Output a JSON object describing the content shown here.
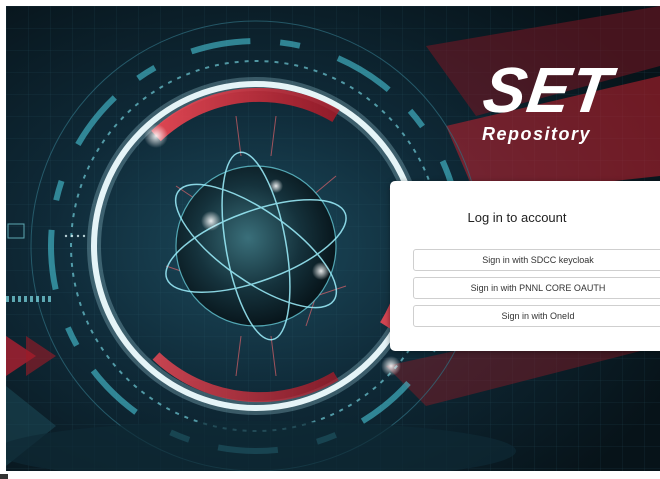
{
  "logo": {
    "main_text": "SET",
    "sub_text": "Repository"
  },
  "login": {
    "title": "Log in to account",
    "buttons": [
      {
        "label": "Sign in with SDCC keycloak"
      },
      {
        "label": "Sign in with PNNL CORE OAUTH"
      },
      {
        "label": "Sign in with OneId"
      }
    ]
  },
  "colors": {
    "background_dark": "#0a1a24",
    "accent_cyan": "#4fd6e8",
    "accent_red": "#e0303c",
    "card_background": "#ffffff"
  }
}
